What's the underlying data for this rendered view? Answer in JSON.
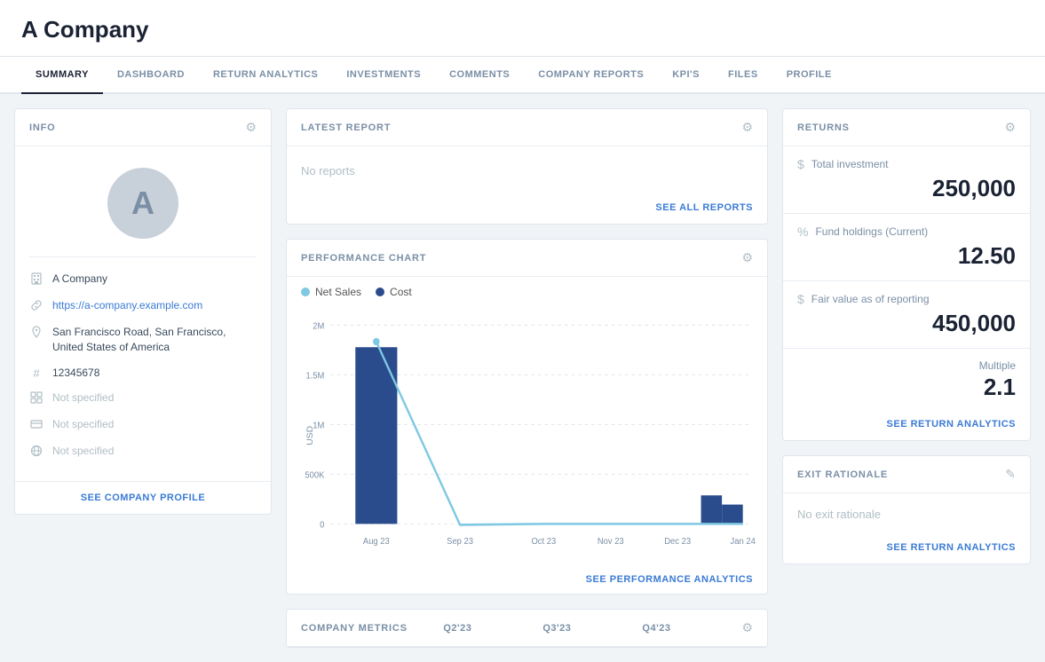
{
  "header": {
    "company_name": "A Company"
  },
  "nav": {
    "items": [
      {
        "label": "SUMMARY",
        "active": true
      },
      {
        "label": "DASHBOARD",
        "active": false
      },
      {
        "label": "RETURN ANALYTICS",
        "active": false
      },
      {
        "label": "INVESTMENTS",
        "active": false
      },
      {
        "label": "COMMENTS",
        "active": false
      },
      {
        "label": "COMPANY REPORTS",
        "active": false
      },
      {
        "label": "KPI'S",
        "active": false
      },
      {
        "label": "FILES",
        "active": false
      },
      {
        "label": "PROFILE",
        "active": false
      }
    ]
  },
  "info": {
    "section_title": "INFO",
    "avatar_letter": "A",
    "fields": [
      {
        "icon": "building",
        "value": "A Company"
      },
      {
        "icon": "link",
        "value": "https://a-company.example.com"
      },
      {
        "icon": "location",
        "value": "San Francisco Road, San Francisco, United States of America"
      },
      {
        "icon": "hash",
        "value": "12345678"
      },
      {
        "icon": "grid",
        "value": "Not specified"
      },
      {
        "icon": "currency",
        "value": "Not specified"
      },
      {
        "icon": "globe",
        "value": "Not specified"
      }
    ],
    "see_profile_link": "SEE COMPANY PROFILE"
  },
  "latest_report": {
    "section_title": "LATEST REPORT",
    "no_data_text": "No reports",
    "see_all_label": "SEE ALL REPORTS"
  },
  "performance_chart": {
    "section_title": "PERFORMANCE CHART",
    "legend": [
      {
        "label": "Net Sales",
        "color": "#7ec8e3"
      },
      {
        "label": "Cost",
        "color": "#2b4c8c"
      }
    ],
    "x_labels": [
      "Aug 23",
      "Sep 23",
      "Oct 23",
      "Nov 23",
      "Dec 23",
      "Jan 24"
    ],
    "y_labels": [
      "2M",
      "1.5M",
      "1M",
      "500K",
      "0"
    ],
    "see_analytics_label": "SEE PERFORMANCE ANALYTICS"
  },
  "returns": {
    "section_title": "RETURNS",
    "total_investment_label": "Total investment",
    "total_investment_value": "250,000",
    "fund_holdings_label": "Fund holdings (Current)",
    "fund_holdings_value": "12.50",
    "fair_value_label": "Fair value as of reporting",
    "fair_value_value": "450,000",
    "multiple_label": "Multiple",
    "multiple_value": "2.1",
    "see_analytics_label": "SEE RETURN ANALYTICS"
  },
  "exit_rationale": {
    "section_title": "EXIT RATIONALE",
    "no_data_text": "No exit rationale",
    "see_analytics_label": "SEE RETURN ANALYTICS"
  },
  "company_metrics": {
    "section_title": "COMPANY METRICS",
    "col_labels": [
      "Q2'23",
      "Q3'23",
      "Q4'23"
    ]
  }
}
